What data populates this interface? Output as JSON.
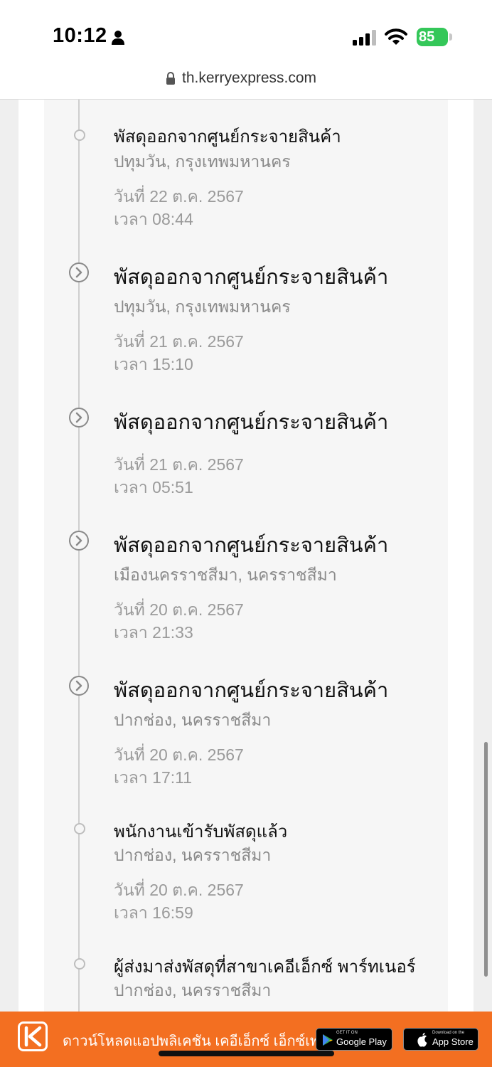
{
  "status_bar": {
    "time": "10:12",
    "battery": "85"
  },
  "url_bar": {
    "url": "th.kerryexpress.com"
  },
  "timeline": [
    {
      "title": "พัสดุออกจากศูนย์กระจายสินค้า",
      "location": "ปทุมวัน, กรุงเทพมหานคร",
      "date": "วันที่ 22 ต.ค. 2567",
      "time": "เวลา 08:44",
      "marker": "dot"
    },
    {
      "title": "พัสดุออกจากศูนย์กระจายสินค้า",
      "location": "ปทุมวัน, กรุงเทพมหานคร",
      "date": "วันที่ 21 ต.ค. 2567",
      "time": "เวลา 15:10",
      "marker": "chevron-circle-icon"
    },
    {
      "title": "พัสดุออกจากศูนย์กระจายสินค้า",
      "location": "",
      "date": "วันที่ 21 ต.ค. 2567",
      "time": "เวลา 05:51",
      "marker": "chevron-circle-icon"
    },
    {
      "title": "พัสดุออกจากศูนย์กระจายสินค้า",
      "location": "เมืองนครราชสีมา, นครราชสีมา",
      "date": "วันที่ 20 ต.ค. 2567",
      "time": "เวลา 21:33",
      "marker": "chevron-circle-icon"
    },
    {
      "title": "พัสดุออกจากศูนย์กระจายสินค้า",
      "location": "ปากช่อง, นครราชสีมา",
      "date": "วันที่ 20 ต.ค. 2567",
      "time": "เวลา 17:11",
      "marker": "chevron-circle-icon"
    },
    {
      "title": "พนักงานเข้ารับพัสดุแล้ว",
      "location": "ปากช่อง, นครราชสีมา",
      "date": "วันที่ 20 ต.ค. 2567",
      "time": "เวลา 16:59",
      "marker": "dot"
    },
    {
      "title": "ผู้ส่งมาส่งพัสดุที่สาขาเคอีเอ็กซ์ พาร์ทเนอร์",
      "location": "ปากช่อง, นครราชสีมา",
      "date": "",
      "time": "",
      "marker": "dot"
    }
  ],
  "banner": {
    "text": "ดาวน์โหลดแอปพลิเคชัน เคอีเอ็กซ์ เอ็กซ์เพรส",
    "google_play_small": "GET IT ON",
    "google_play_label": "Google Play",
    "app_store_small": "Download on the",
    "app_store_label": "App Store",
    "color": "#f36f21"
  }
}
